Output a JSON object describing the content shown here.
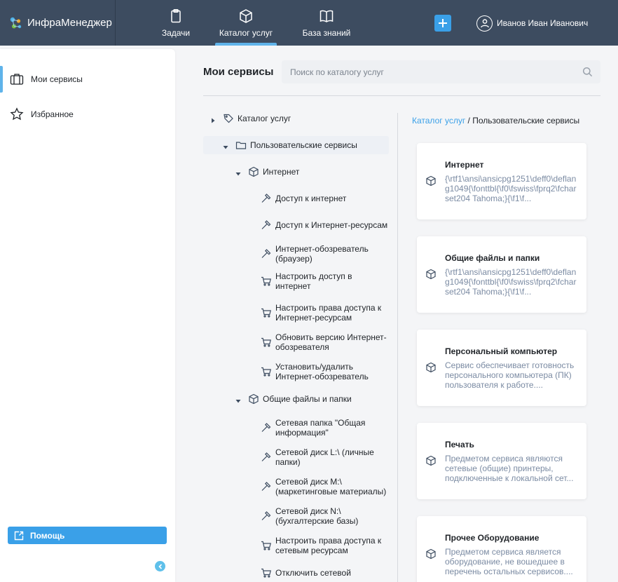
{
  "app": {
    "name": "ИнфраМенеджер"
  },
  "nav": [
    {
      "label": "Задачи",
      "icon": "clipboard-icon"
    },
    {
      "label": "Каталог услуг",
      "icon": "cube-icon"
    },
    {
      "label": "База знаний",
      "icon": "book-icon"
    }
  ],
  "user": {
    "name": "Иванов Иван Иванович"
  },
  "sidebar": {
    "items": [
      {
        "label": "Мои сервисы",
        "icon": "briefcase-icon"
      },
      {
        "label": "Избранное",
        "icon": "star-icon"
      }
    ],
    "help_label": "Помощь"
  },
  "page": {
    "title": "Мои сервисы"
  },
  "search": {
    "placeholder": "Поиск по каталогу услуг"
  },
  "tree": [
    {
      "label": "Каталог услуг",
      "type": "tag",
      "level": 0,
      "caret": "right"
    },
    {
      "label": "Пользовательские сервисы",
      "type": "folder",
      "level": 1,
      "caret": "down",
      "selected": true
    },
    {
      "label": "Интернет",
      "type": "cube",
      "level": 2,
      "caret": "down"
    },
    {
      "label": "Доступ к интернет",
      "type": "hammer",
      "level": 3
    },
    {
      "label": "Доступ к Интернет-ресурсам",
      "type": "hammer",
      "level": 3
    },
    {
      "label": "Интернет-обозреватель (браузер)",
      "type": "hammer",
      "level": 3
    },
    {
      "label": "Настроить доступ в интернет",
      "type": "cart",
      "level": 3
    },
    {
      "label": "Настроить права доступа к Интернет-ресурсам",
      "type": "cart",
      "level": 3
    },
    {
      "label": "Обновить версию Интернет-обозревателя",
      "type": "cart",
      "level": 3
    },
    {
      "label": "Установить/удалить Интернет-обозреватель",
      "type": "cart",
      "level": 3
    },
    {
      "label": "Общие файлы и папки",
      "type": "cube",
      "level": 2,
      "caret": "down"
    },
    {
      "label": "Сетевая папка \"Общая информация\"",
      "type": "hammer",
      "level": 3
    },
    {
      "label": "Сетевой диск L:\\ (личные папки)",
      "type": "hammer",
      "level": 3
    },
    {
      "label": "Сетевой диск M:\\ (маркетинговые материалы)",
      "type": "hammer",
      "level": 3
    },
    {
      "label": "Сетевой диск N:\\ (бухгалтерские базы)",
      "type": "hammer",
      "level": 3
    },
    {
      "label": "Настроить права доступа к сетевым ресурсам",
      "type": "cart",
      "level": 3
    },
    {
      "label": "Отключить сетевой",
      "type": "cart",
      "level": 3
    }
  ],
  "breadcrumb": {
    "link": "Каталог услуг",
    "separator": " / ",
    "current": "Пользовательские сервисы"
  },
  "cards": [
    {
      "title": "Интернет",
      "description": "{\\rtf1\\ansi\\ansicpg1251\\deff0\\deflang1049{\\fonttbl{\\f0\\fswiss\\fprq2\\fcharset204 Tahoma;}{\\f1\\f..."
    },
    {
      "title": "Общие файлы и папки",
      "description": "{\\rtf1\\ansi\\ansicpg1251\\deff0\\deflang1049{\\fonttbl{\\f0\\fswiss\\fprq2\\fcharset204 Tahoma;}{\\f1\\f..."
    },
    {
      "title": "Персональный компьютер",
      "description": "Сервис обеспечивает  готовность персонального компьютера (ПК) пользователя к работе...."
    },
    {
      "title": "Печать",
      "description": "Предметом сервиса являются сетевые (общие) принтеры, подключенные к локальной сет..."
    },
    {
      "title": "Прочее Оборудование",
      "description": "Предметом сервиса является оборудование, не вошедшее в перечень остальных сервисов...."
    }
  ],
  "colors": {
    "topbar": "#3d4c60",
    "accent": "#3aa0e8",
    "active_indicator": "#5fb3ea",
    "selected_row": "#edf0f5",
    "description_text": "#7b8ba3"
  }
}
